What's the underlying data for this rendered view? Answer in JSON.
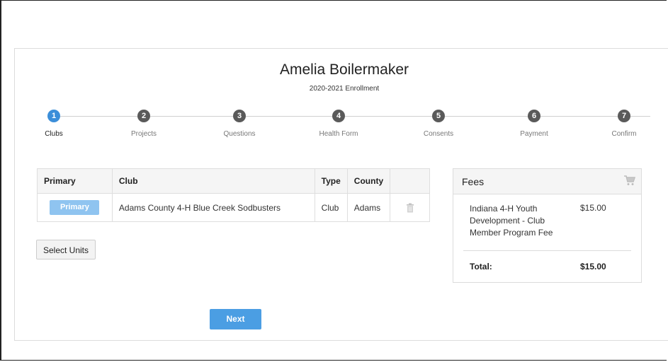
{
  "member": {
    "name": "Amelia Boilermaker",
    "enrollment": "2020-2021 Enrollment"
  },
  "steps": [
    {
      "number": "1",
      "label": "Clubs",
      "active": true
    },
    {
      "number": "2",
      "label": "Projects"
    },
    {
      "number": "3",
      "label": "Questions"
    },
    {
      "number": "4",
      "label": "Health Form"
    },
    {
      "number": "5",
      "label": "Consents"
    },
    {
      "number": "6",
      "label": "Payment"
    },
    {
      "number": "7",
      "label": "Confirm"
    }
  ],
  "units_table": {
    "headers": [
      "Primary",
      "Club",
      "Type",
      "County",
      ""
    ],
    "rows": [
      {
        "primary_label": "Primary",
        "club": "Adams County 4-H Blue Creek Sodbusters",
        "type": "Club",
        "county": "Adams",
        "action_icon": "trash-icon"
      }
    ]
  },
  "buttons": {
    "select_units": "Select Units",
    "next": "Next"
  },
  "fees": {
    "title": "Fees",
    "icon": "cart-icon",
    "items": [
      {
        "description": "Indiana 4-H Youth Development - Club Member Program Fee",
        "amount": "$15.00"
      }
    ],
    "total_label": "Total:",
    "total_amount": "$15.00"
  },
  "colors": {
    "active_step": "#3b8ed9",
    "inactive_step": "#5a5a5a",
    "primary_button": "#8fc4f0",
    "next_button": "#4b9ee3"
  }
}
